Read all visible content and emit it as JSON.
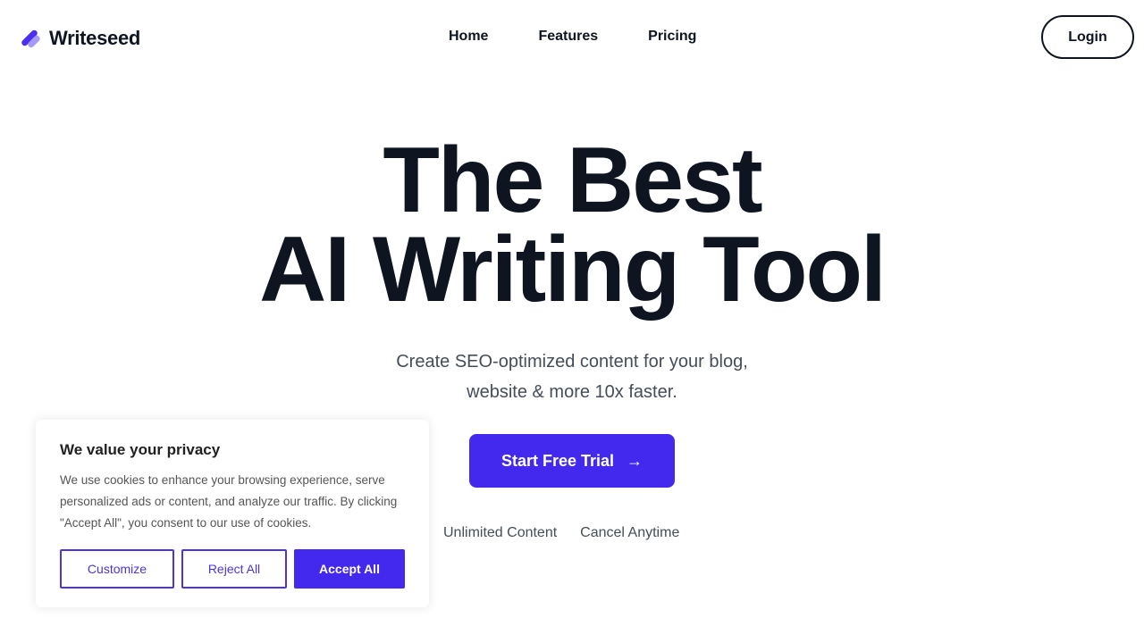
{
  "brand": {
    "name": "Writeseed",
    "logo_icon": "double-slash-logo-icon",
    "accent_color": "#4328ee",
    "accent_light": "#a59af5"
  },
  "nav": {
    "links": [
      {
        "label": "Home"
      },
      {
        "label": "Features"
      },
      {
        "label": "Pricing"
      }
    ],
    "login_label": "Login"
  },
  "hero": {
    "title_line1": "The Best",
    "title_line2": "AI Writing Tool",
    "subtitle_line1": "Create SEO-optimized content for your blog,",
    "subtitle_line2": "website & more 10x faster.",
    "cta_label": "Start Free Trial",
    "cta_icon": "arrow-right-icon",
    "cta_arrow": "→",
    "perks": [
      "Unlimited Content",
      "Cancel Anytime"
    ]
  },
  "cookie_banner": {
    "title": "We value your privacy",
    "text": "We use cookies to enhance your browsing experience, serve personalized ads or content, and analyze our traffic. By clicking \"Accept All\", you consent to our use of cookies.",
    "customize_label": "Customize",
    "reject_label": "Reject All",
    "accept_label": "Accept All"
  }
}
